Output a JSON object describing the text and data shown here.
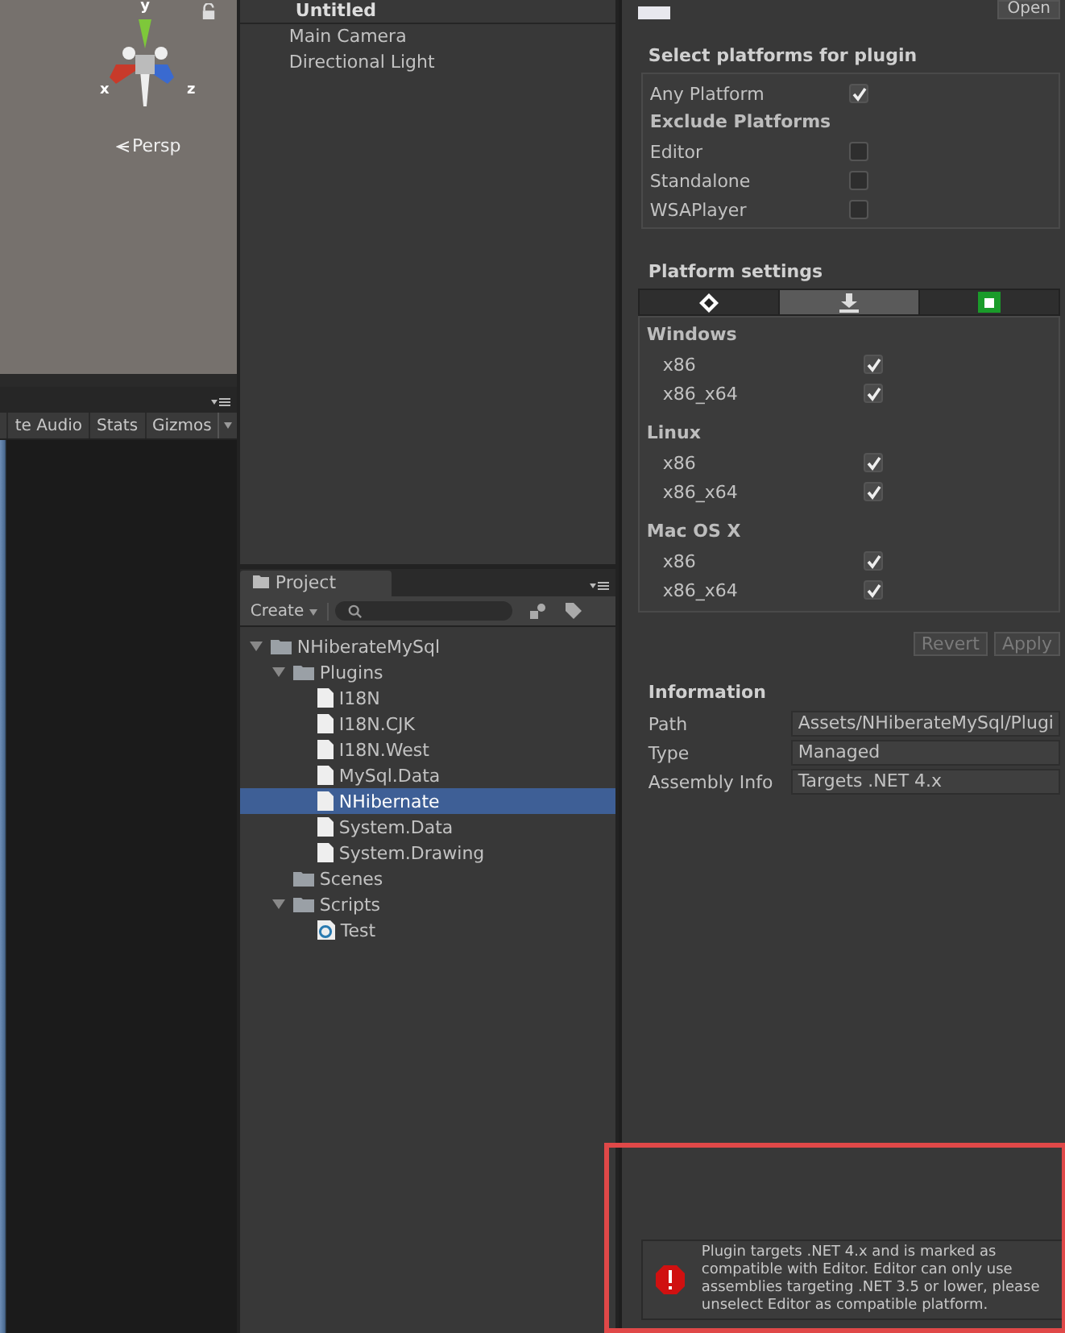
{
  "scene_view": {
    "axis_labels": [
      "y",
      "x",
      "z"
    ],
    "projection": "Persp",
    "toolbar": [
      "te Audio",
      "Stats",
      "Gizmos"
    ]
  },
  "hierarchy": {
    "scene": "Untitled",
    "items": [
      "Main Camera",
      "Directional Light"
    ]
  },
  "project": {
    "tab": "Project",
    "create": "Create",
    "tree": [
      {
        "name": "NHiberateMySql",
        "kind": "folder",
        "expanded": true,
        "selected": false,
        "children": [
          {
            "name": "Plugins",
            "kind": "folder",
            "expanded": true,
            "selected": false,
            "children": [
              {
                "name": "I18N",
                "kind": "file",
                "selected": false
              },
              {
                "name": "I18N.CJK",
                "kind": "file",
                "selected": false
              },
              {
                "name": "I18N.West",
                "kind": "file",
                "selected": false
              },
              {
                "name": "MySql.Data",
                "kind": "file",
                "selected": false
              },
              {
                "name": "NHibernate",
                "kind": "file",
                "selected": true
              },
              {
                "name": "System.Data",
                "kind": "file",
                "selected": false
              },
              {
                "name": "System.Drawing",
                "kind": "file",
                "selected": false
              }
            ]
          },
          {
            "name": "Scenes",
            "kind": "folder",
            "selected": false
          },
          {
            "name": "Scripts",
            "kind": "folder",
            "expanded": true,
            "selected": false,
            "children": [
              {
                "name": "Test",
                "kind": "script",
                "selected": false
              }
            ]
          }
        ]
      }
    ]
  },
  "inspector": {
    "open_button": "Open",
    "platforms_title": "Select platforms for plugin",
    "any_platform": {
      "label": "Any Platform",
      "checked": true
    },
    "exclude_title": "Exclude Platforms",
    "exclude": [
      {
        "label": "Editor",
        "checked": false
      },
      {
        "label": "Standalone",
        "checked": false
      },
      {
        "label": "WSAPlayer",
        "checked": false
      }
    ],
    "settings_title": "Platform settings",
    "platform_tabs": [
      {
        "kind": "unity",
        "selected": false
      },
      {
        "kind": "download",
        "selected": true
      },
      {
        "kind": "store",
        "selected": false
      }
    ],
    "groups": [
      {
        "name": "Windows",
        "options": [
          {
            "label": "x86",
            "checked": true
          },
          {
            "label": "x86_x64",
            "checked": true
          }
        ]
      },
      {
        "name": "Linux",
        "options": [
          {
            "label": "x86",
            "checked": true
          },
          {
            "label": "x86_x64",
            "checked": true
          }
        ]
      },
      {
        "name": "Mac OS X",
        "options": [
          {
            "label": "x86",
            "checked": true
          },
          {
            "label": "x86_x64",
            "checked": true
          }
        ]
      }
    ],
    "buttons": [
      {
        "label": "Revert",
        "disabled": true
      },
      {
        "label": "Apply",
        "disabled": true
      }
    ],
    "information_title": "Information",
    "info": [
      {
        "label": "Path",
        "value": "Assets/NHiberateMySql/Plugi"
      },
      {
        "label": "Type",
        "value": "Managed"
      },
      {
        "label": "Assembly Info",
        "value": "Targets .NET 4.x"
      }
    ],
    "error": "Plugin targets .NET 4.x and is marked as compatible with Editor. Editor can only use assemblies targeting .NET 3.5 or lower, please unselect Editor as compatible platform."
  }
}
